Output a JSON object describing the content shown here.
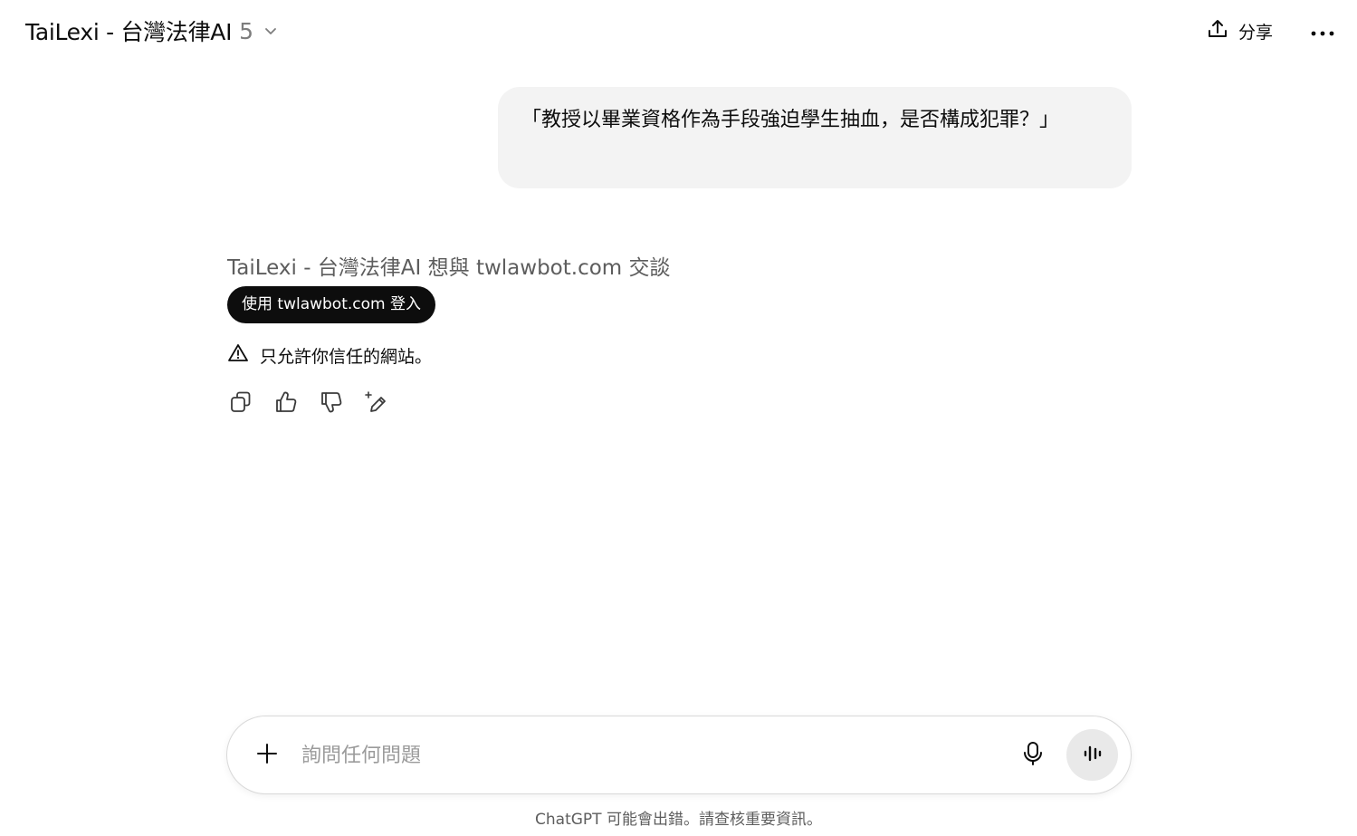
{
  "header": {
    "model_name": "TaiLexi - 台灣法律AI",
    "model_version": "5",
    "share_label": "分享"
  },
  "conversation": {
    "user_message": "「教授以畢業資格作為手段強迫學生抽血，是否構成犯罪？」",
    "gizmo_request": "TaiLexi - 台灣法律AI 想與 twlawbot.com 交談",
    "login_button": "使用 twlawbot.com 登入",
    "warning": "只允許你信任的網站。"
  },
  "composer": {
    "placeholder": "詢問任何問題"
  },
  "footer": {
    "disclaimer": "ChatGPT 可能會出錯。請查核重要資訊。"
  },
  "icons": [
    "chevron-down-icon",
    "share-icon",
    "more-icon",
    "warning-icon",
    "copy-icon",
    "thumbs-up-icon",
    "thumbs-down-icon",
    "edit-sparkle-icon",
    "plus-icon",
    "microphone-icon",
    "voice-mode-icon"
  ]
}
